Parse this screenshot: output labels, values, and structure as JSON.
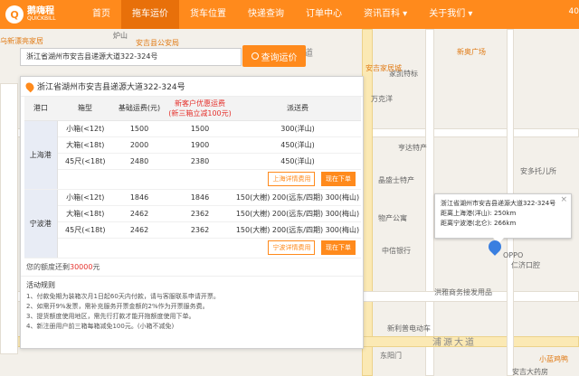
{
  "nav": {
    "logo_cn": "鹅嗨程",
    "logo_en": "QUICKBILL",
    "items": [
      {
        "label": "首页",
        "active": false
      },
      {
        "label": "拖车运价",
        "active": true
      },
      {
        "label": "货车位置",
        "active": false
      },
      {
        "label": "快递查询",
        "active": false
      },
      {
        "label": "订单中心",
        "active": false
      },
      {
        "label": "资讯百科 ▾",
        "active": false
      },
      {
        "label": "关于我们 ▾",
        "active": false
      }
    ],
    "phone_hint": "40"
  },
  "search": {
    "value": "浙江省湖州市安吉县递源大道322-324号",
    "button_label": "查询运价"
  },
  "panel": {
    "address": "浙江省湖州市安吉县递源大道322-324号",
    "columns": [
      "港口",
      "箱型",
      "基础运费(元)",
      "新客户优惠运费\n(新三箱立减100元)",
      "派送费"
    ],
    "ports": [
      {
        "name": "上海港",
        "rows": [
          {
            "box": "小箱(<12t)",
            "base": "1500",
            "discount": "1500",
            "delivery": "300(洋山)"
          },
          {
            "box": "大箱(<18t)",
            "base": "2000",
            "discount": "1900",
            "delivery": "450(洋山)"
          },
          {
            "box": "45尺(<18t)",
            "base": "2480",
            "discount": "2380",
            "delivery": "450(洋山)"
          }
        ],
        "detail_button": "上海详情费用",
        "order_button": "现在下单"
      },
      {
        "name": "宁波港",
        "rows": [
          {
            "box": "小箱(<12t)",
            "base": "1846",
            "discount": "1846",
            "delivery": "150(大榭) 200(远东/四期) 300(梅山)"
          },
          {
            "box": "大箱(<18t)",
            "base": "2462",
            "discount": "2362",
            "delivery": "150(大榭) 200(远东/四期) 300(梅山)"
          },
          {
            "box": "45尺(<18t)",
            "base": "2462",
            "discount": "2362",
            "delivery": "150(大榭) 200(远东/四期) 300(梅山)"
          }
        ],
        "detail_button": "宁波详情费用",
        "order_button": "现在下单"
      }
    ],
    "credit_prefix": "您的额度还剩",
    "credit_amount": "30000",
    "credit_suffix": "元",
    "rules_title": "活动规则",
    "rules": [
      "1、付款免期为装箱次月1日起60天内付款，请与客服联系申请开票。",
      "2、如需开9%发票，需补充服务开票金额的2%作为开票服务费。",
      "3、提货额度使用地区，需先行打款才能开拖额度使用下单。",
      "4、新注册用户前三箱每箱减免100元。(小箱不减免)"
    ]
  },
  "popup": {
    "address": "浙江省湖州市安吉县递源大道322-324号",
    "line1": "距离上海港(洋山): 250km",
    "line2": "距离宁波港(北仑): 266km",
    "close": "×"
  },
  "map_labels": [
    "乌新漂亮家居",
    "炉山",
    "安吉县公安局",
    "浙源大道",
    "万克洋",
    "家凯特标",
    "新奥广场",
    "安吉家居城",
    "亨达特产",
    "晶盛士特产",
    "安多托儿所",
    "物产公寓",
    "中信银行",
    "仁济口腔",
    "洪雅商务接发用品",
    "新利普电动车",
    "东阳门",
    "小蓝鸡鸭",
    "OPPO",
    "安吉大药房",
    "浦源大道"
  ]
}
